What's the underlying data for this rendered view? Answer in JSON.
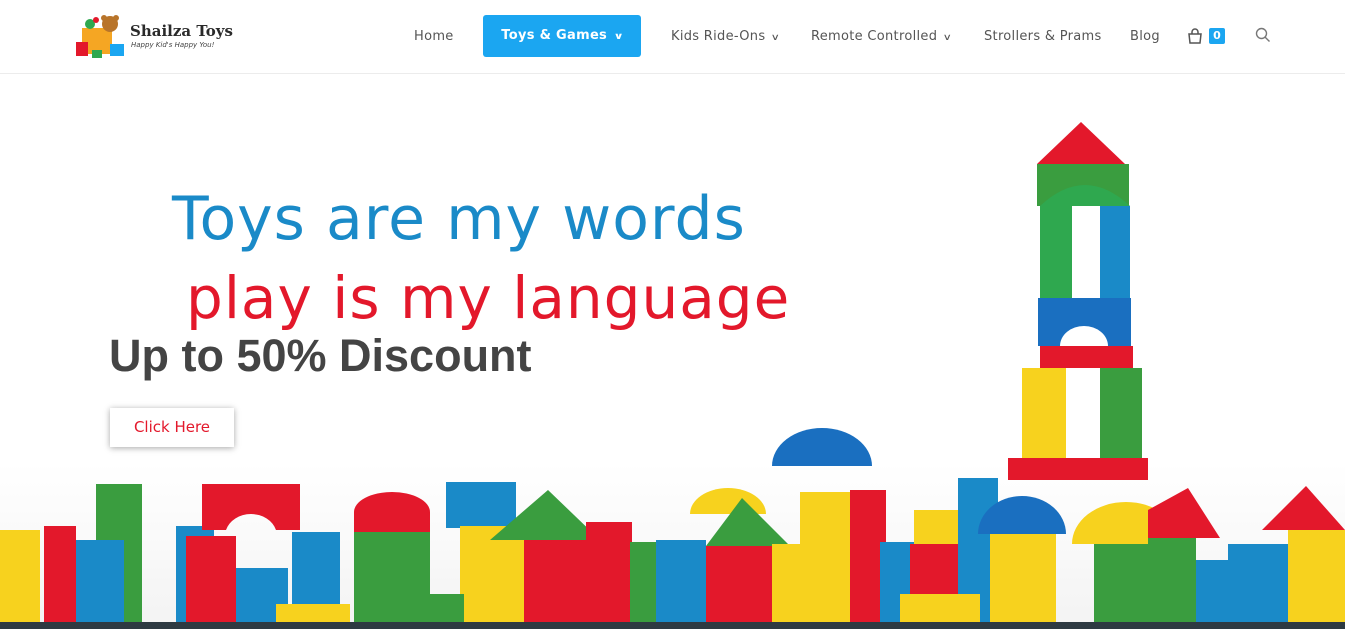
{
  "brand": {
    "name": "Shailza Toys",
    "tagline": "Happy Kid's Happy You!"
  },
  "nav": {
    "items": [
      {
        "label": "Home",
        "has_dropdown": false
      },
      {
        "label": "Toys & Games",
        "has_dropdown": true,
        "active": true
      },
      {
        "label": "Kids Ride-Ons",
        "has_dropdown": true
      },
      {
        "label": "Remote Controlled",
        "has_dropdown": true
      },
      {
        "label": "Strollers & Prams",
        "has_dropdown": false
      },
      {
        "label": "Blog",
        "has_dropdown": false
      }
    ],
    "cart_count": "0",
    "cart_icon": "shopping-bag-icon",
    "search_icon": "search-icon"
  },
  "hero": {
    "slogan_line1": "Toys are my words",
    "slogan_line2": "play is my language",
    "headline": "Up to 50% Discount",
    "cta_label": "Click Here"
  },
  "colors": {
    "accent": "#1ba6f1",
    "slogan_blue": "#1a8ac8",
    "slogan_red": "#e3182b",
    "headline": "#444444"
  }
}
